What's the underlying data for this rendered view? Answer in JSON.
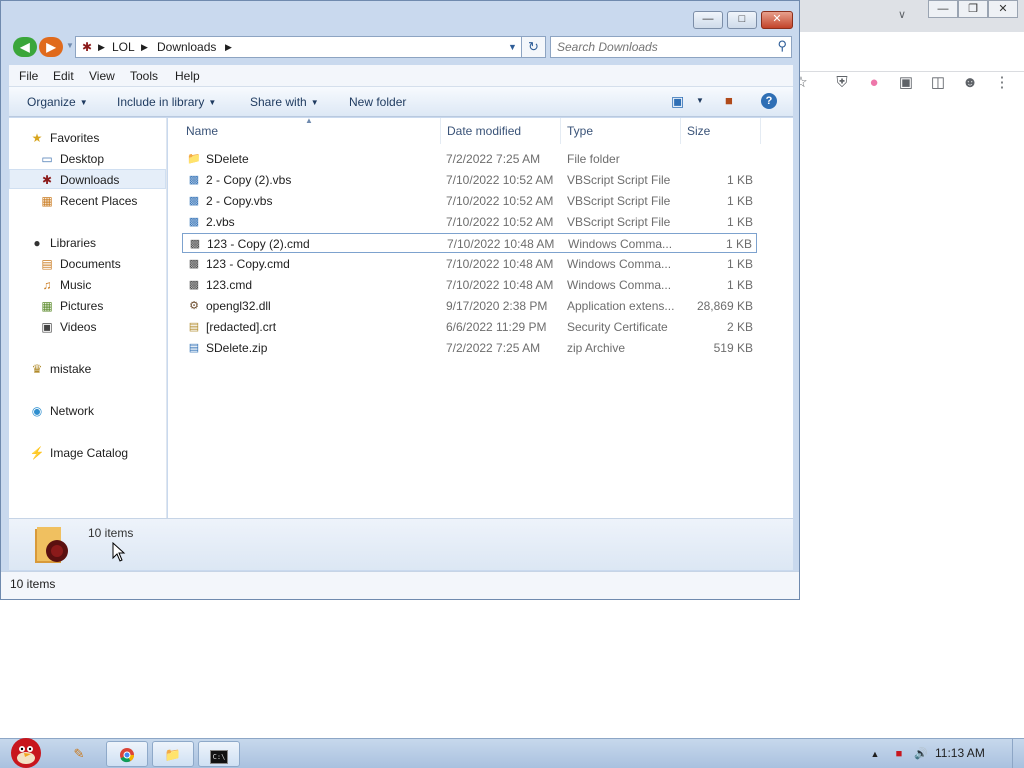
{
  "window": {
    "controls": [
      "minimize",
      "maximize",
      "close"
    ]
  },
  "address": {
    "segments": [
      "LOL",
      "Downloads"
    ]
  },
  "search": {
    "placeholder": "Search Downloads"
  },
  "menu": {
    "items": [
      "File",
      "Edit",
      "View",
      "Tools",
      "Help"
    ]
  },
  "commands": {
    "organize": "Organize",
    "include": "Include in library",
    "share": "Share with",
    "new_folder": "New folder"
  },
  "nav": {
    "favorites": "Favorites",
    "desktop": "Desktop",
    "downloads": "Downloads",
    "recent": "Recent Places",
    "libraries": "Libraries",
    "documents": "Documents",
    "music": "Music",
    "pictures": "Pictures",
    "videos": "Videos",
    "mistake": "mistake",
    "network": "Network",
    "image_catalog": "Image Catalog"
  },
  "columns": {
    "name": "Name",
    "date": "Date modified",
    "type": "Type",
    "size": "Size"
  },
  "files": [
    {
      "name": "SDelete",
      "date": "7/2/2022 7:25 AM",
      "type": "File folder",
      "size": "",
      "icon": "folder-icon"
    },
    {
      "name": "2 - Copy (2).vbs",
      "date": "7/10/2022 10:52 AM",
      "type": "VBScript Script File",
      "size": "1 KB",
      "icon": "vbs-icon"
    },
    {
      "name": "2 - Copy.vbs",
      "date": "7/10/2022 10:52 AM",
      "type": "VBScript Script File",
      "size": "1 KB",
      "icon": "vbs-icon"
    },
    {
      "name": "2.vbs",
      "date": "7/10/2022 10:52 AM",
      "type": "VBScript Script File",
      "size": "1 KB",
      "icon": "vbs-icon"
    },
    {
      "name": "123 - Copy (2).cmd",
      "date": "7/10/2022 10:48 AM",
      "type": "Windows Comma...",
      "size": "1 KB",
      "icon": "cmd-icon"
    },
    {
      "name": "123 - Copy.cmd",
      "date": "7/10/2022 10:48 AM",
      "type": "Windows Comma...",
      "size": "1 KB",
      "icon": "cmd-icon"
    },
    {
      "name": "123.cmd",
      "date": "7/10/2022 10:48 AM",
      "type": "Windows Comma...",
      "size": "1 KB",
      "icon": "cmd-icon"
    },
    {
      "name": "opengl32.dll",
      "date": "9/17/2020 2:38 PM",
      "type": "Application extens...",
      "size": "28,869 KB",
      "icon": "dll-icon"
    },
    {
      "name": "[redacted].crt",
      "date": "6/6/2022 11:29 PM",
      "type": "Security Certificate",
      "size": "2 KB",
      "icon": "certificate-icon"
    },
    {
      "name": "SDelete.zip",
      "date": "7/2/2022 7:25 AM",
      "type": "zip Archive",
      "size": "519 KB",
      "icon": "zip-icon"
    }
  ],
  "details": {
    "count": "10 items"
  },
  "status": {
    "text": "10 items"
  },
  "taskbar": {
    "clock": "11:13 AM"
  }
}
